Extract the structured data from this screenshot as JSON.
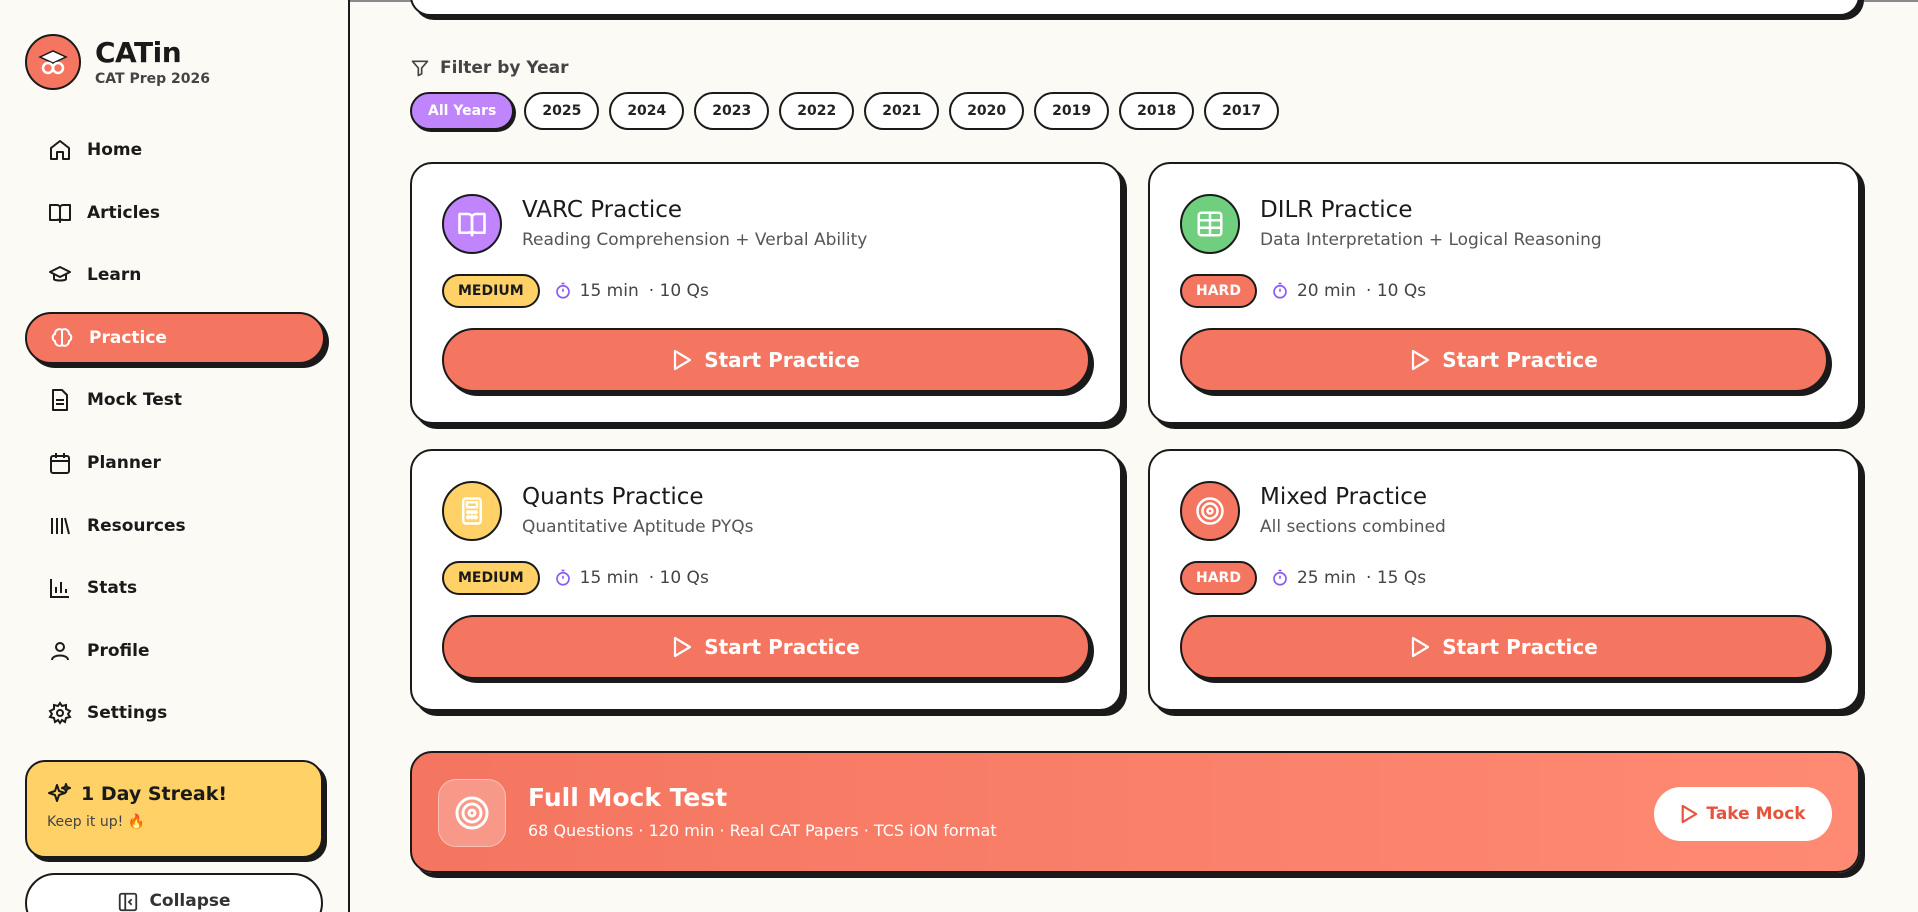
{
  "brand": {
    "title": "CATin",
    "subtitle": "CAT Prep 2026"
  },
  "nav": [
    {
      "label": "Home",
      "icon": "home-icon"
    },
    {
      "label": "Articles",
      "icon": "book-open-icon"
    },
    {
      "label": "Learn",
      "icon": "graduation-cap-icon"
    },
    {
      "label": "Practice",
      "icon": "brain-icon",
      "active": true
    },
    {
      "label": "Mock Test",
      "icon": "file-text-icon"
    },
    {
      "label": "Planner",
      "icon": "calendar-icon"
    },
    {
      "label": "Resources",
      "icon": "library-icon"
    },
    {
      "label": "Stats",
      "icon": "bar-chart-icon"
    },
    {
      "label": "Profile",
      "icon": "user-icon"
    },
    {
      "label": "Settings",
      "icon": "gear-icon"
    }
  ],
  "streak": {
    "title": "1 Day Streak!",
    "subtitle": "Keep it up! 🔥"
  },
  "collapse_label": "Collapse",
  "filter": {
    "label": "Filter by Year",
    "years": [
      "All Years",
      "2025",
      "2024",
      "2023",
      "2022",
      "2021",
      "2020",
      "2019",
      "2018",
      "2017"
    ],
    "selected": "All Years"
  },
  "cards": [
    {
      "title": "VARC Practice",
      "subtitle": "Reading Comprehension + Verbal Ability",
      "difficulty": "MEDIUM",
      "time": "15 min",
      "questions": "· 10 Qs",
      "button": "Start Practice",
      "icon": "book-open-icon",
      "icon_color": "#c084fc"
    },
    {
      "title": "DILR Practice",
      "subtitle": "Data Interpretation + Logical Reasoning",
      "difficulty": "HARD",
      "time": "20 min",
      "questions": "· 10 Qs",
      "button": "Start Practice",
      "icon": "table-icon",
      "icon_color": "#6fcf7f"
    },
    {
      "title": "Quants Practice",
      "subtitle": "Quantitative Aptitude PYQs",
      "difficulty": "MEDIUM",
      "time": "15 min",
      "questions": "· 10 Qs",
      "button": "Start Practice",
      "icon": "calculator-icon",
      "icon_color": "#ffd166"
    },
    {
      "title": "Mixed Practice",
      "subtitle": "All sections combined",
      "difficulty": "HARD",
      "time": "25 min",
      "questions": "· 15 Qs",
      "button": "Start Practice",
      "icon": "target-icon",
      "icon_color": "#f47560"
    }
  ],
  "mock": {
    "title": "Full Mock Test",
    "subtitle": "68 Questions · 120 min · Real CAT Papers · TCS iON format",
    "button": "Take Mock"
  },
  "colors": {
    "accent": "#f47560",
    "purple": "#c084fc",
    "yellow": "#ffd166",
    "green": "#6fcf7f",
    "ink": "#1a1a1a"
  }
}
